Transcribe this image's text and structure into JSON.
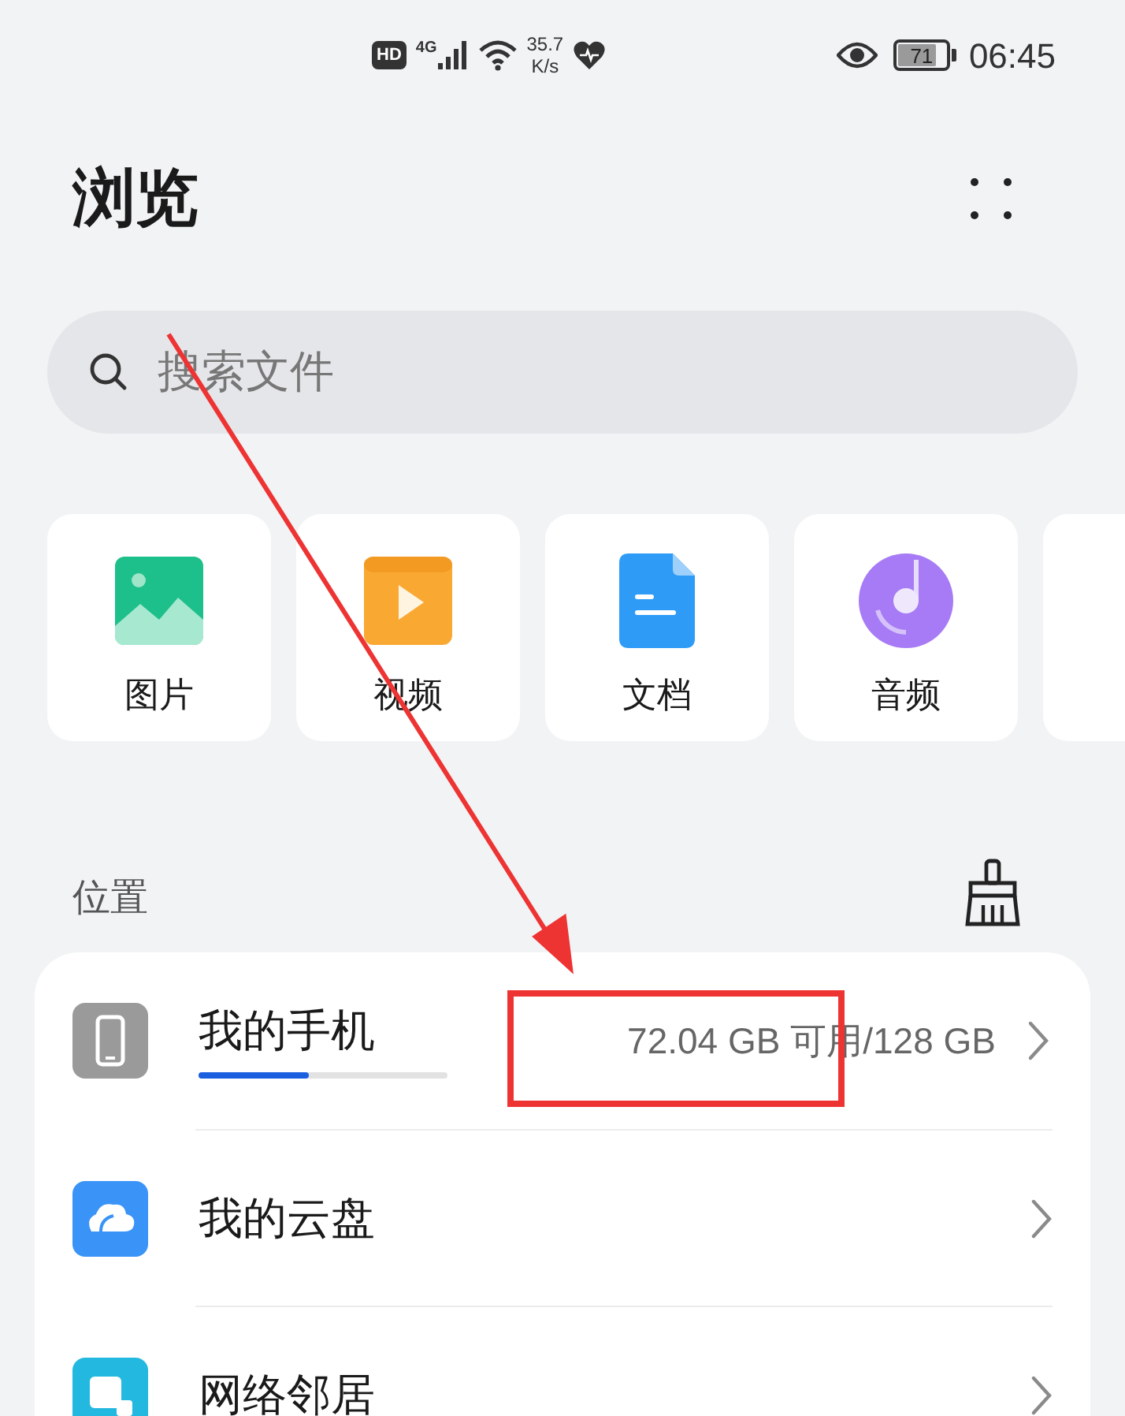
{
  "status_bar": {
    "hd": "HD",
    "network": "4G",
    "speed_value": "35.7",
    "speed_unit": "K/s",
    "battery": "71",
    "time": "06:45"
  },
  "header": {
    "title": "浏览"
  },
  "search": {
    "placeholder": "搜索文件"
  },
  "categories": [
    {
      "kind": "image",
      "label": "图片"
    },
    {
      "kind": "video",
      "label": "视频"
    },
    {
      "kind": "document",
      "label": "文档"
    },
    {
      "kind": "audio",
      "label": "音频"
    },
    {
      "kind": "partial"
    }
  ],
  "locations": {
    "title": "位置",
    "items": [
      {
        "kind": "phone",
        "label": "我的手机",
        "level": 0.44,
        "detail": "72.04 GB 可用/128 GB"
      },
      {
        "kind": "cloud",
        "label": "我的云盘"
      },
      {
        "kind": "network",
        "label": "网络邻居"
      }
    ]
  }
}
